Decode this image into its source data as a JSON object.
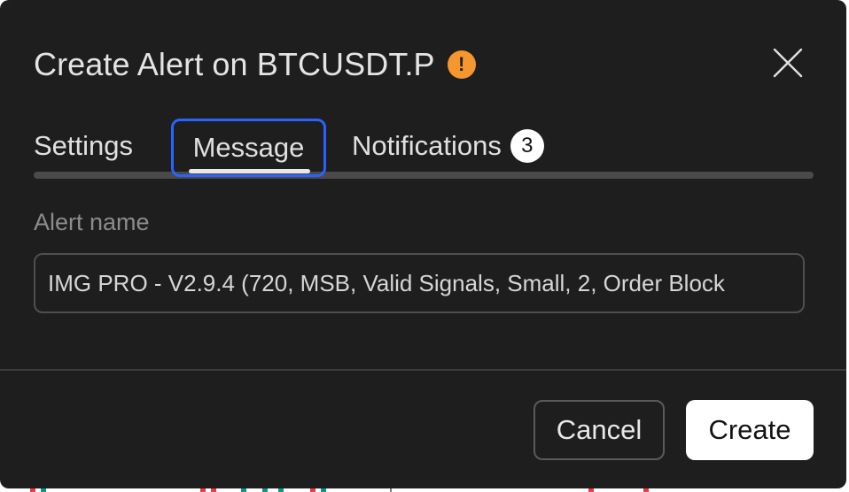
{
  "dialog": {
    "title": "Create Alert on BTCUSDT.P",
    "warning_icon": "exclamation-circle-icon",
    "warning_glyph": "!",
    "warning_color": "#f5962e",
    "close_icon": "close-icon"
  },
  "tabs": [
    {
      "label": "Settings",
      "active": false
    },
    {
      "label": "Message",
      "active": true
    },
    {
      "label": "Notifications",
      "active": false,
      "badge": "3"
    }
  ],
  "form": {
    "alert_name_label": "Alert name",
    "alert_name_value": "IMG PRO - V2.9.4 (720, MSB, Valid Signals, Small, 2, Order Block"
  },
  "footer": {
    "cancel_label": "Cancel",
    "create_label": "Create"
  },
  "colors": {
    "dialog_bg": "#1e1e1e",
    "focus_ring": "#2962ff",
    "primary_button_bg": "#ffffff"
  }
}
